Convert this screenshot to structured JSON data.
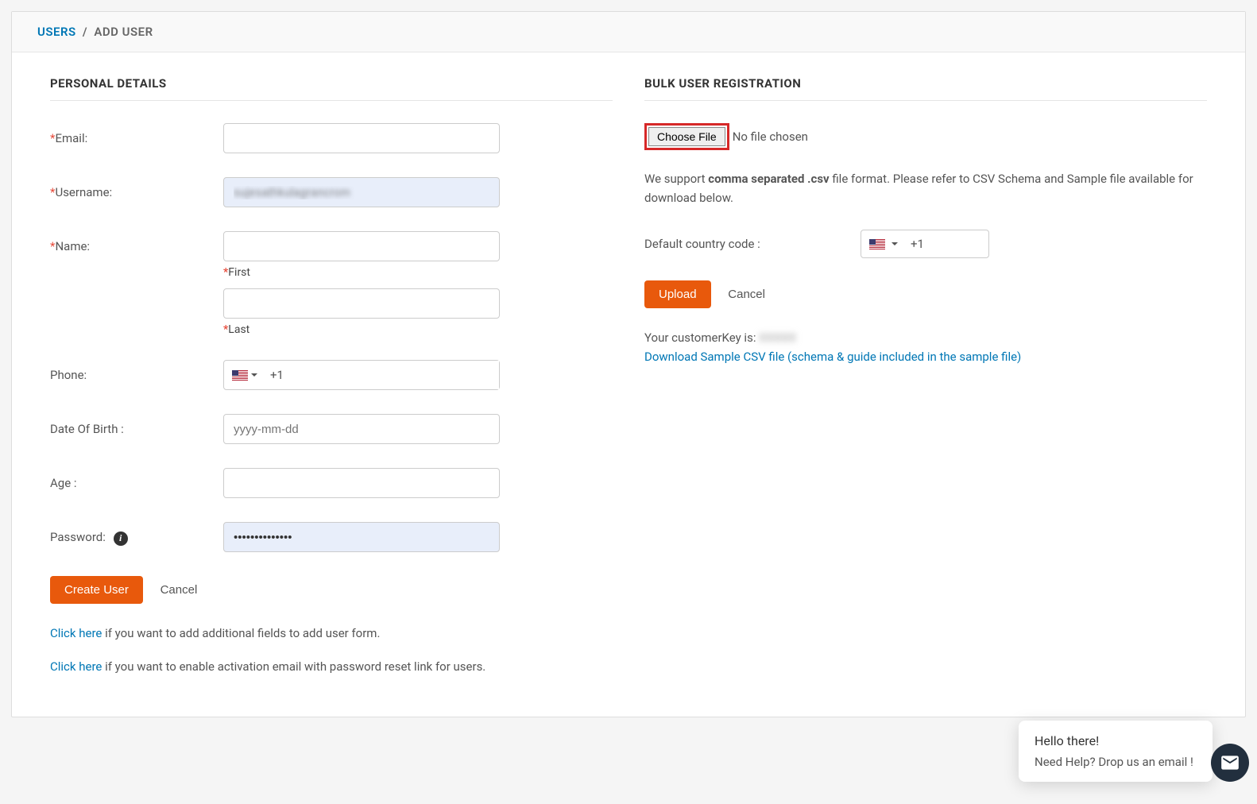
{
  "breadcrumb": {
    "link": "USERS",
    "sep": "/",
    "current": "ADD USER"
  },
  "personal": {
    "title": "PERSONAL DETAILS",
    "fields": {
      "email_label": "Email:",
      "username_label": "Username:",
      "username_value": "sujesathkulagrancrom",
      "name_label": "Name:",
      "first_label": "First",
      "last_label": "Last",
      "phone_label": "Phone:",
      "dial_code": "+1",
      "dob_label": "Date Of Birth :",
      "dob_placeholder": "yyyy-mm-dd",
      "age_label": "Age :",
      "password_label": "Password:",
      "password_value": "••••••••••••••"
    },
    "actions": {
      "create": "Create User",
      "cancel": "Cancel"
    },
    "help1_link": "Click here",
    "help1_text": " if you want to add additional fields to add user form.",
    "help2_link": "Click here",
    "help2_text": " if you want to enable activation email with password reset link for users."
  },
  "bulk": {
    "title": "BULK USER REGISTRATION",
    "choose_file": "Choose File",
    "no_file": "No file chosen",
    "support_pre": "We support ",
    "support_bold": "comma separated .csv",
    "support_post": " file format. Please refer to CSV Schema and Sample file available for download below.",
    "cc_label": "Default country code :",
    "cc_dial": "+1",
    "upload": "Upload",
    "cancel": "Cancel",
    "key_label": "Your customerKey is: ",
    "key_value": "XXXXX",
    "download_link": "Download Sample CSV file (schema & guide included in the sample file)"
  },
  "chat": {
    "greet": "Hello there!",
    "msg": "Need Help? Drop us an email !"
  }
}
